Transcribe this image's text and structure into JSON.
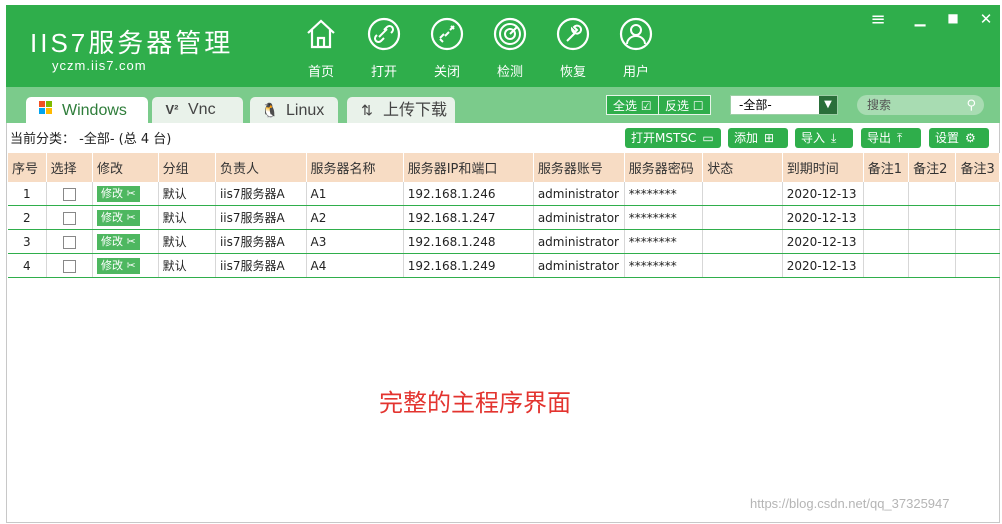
{
  "app": {
    "brand": "IIS7服务器管理",
    "domain": "yczm.iis7.com"
  },
  "toolbar": [
    {
      "label": "首页",
      "icon": "home-icon"
    },
    {
      "label": "打开",
      "icon": "link-icon"
    },
    {
      "label": "关闭",
      "icon": "unlink-icon"
    },
    {
      "label": "检测",
      "icon": "radar-icon"
    },
    {
      "label": "恢复",
      "icon": "wrench-icon"
    },
    {
      "label": "用户",
      "icon": "user-icon"
    }
  ],
  "tabs": [
    {
      "label": "Windows",
      "icon": "windows-icon",
      "active": true
    },
    {
      "label": "Vnc",
      "icon": "vnc-icon",
      "active": false
    },
    {
      "label": "Linux",
      "icon": "linux-icon",
      "active": false
    },
    {
      "label": "上传下载",
      "icon": "transfer-icon",
      "active": false
    }
  ],
  "filter": {
    "select_all": "全选",
    "invert_select": "反选",
    "group_value": "-全部-",
    "search_placeholder": "搜索"
  },
  "info": {
    "category_text": "当前分类： -全部- (总 4 台)"
  },
  "actions": {
    "open_mstsc": "打开MSTSC",
    "add": "添加",
    "import": "导入",
    "export": "导出",
    "settings": "设置"
  },
  "table": {
    "columns": [
      "序号",
      "选择",
      "修改",
      "分组",
      "负责人",
      "服务器名称",
      "服务器IP和端口",
      "服务器账号",
      "服务器密码",
      "状态",
      "到期时间",
      "备注1",
      "备注2",
      "备注3"
    ],
    "edit_label": "修改",
    "rows": [
      {
        "no": "1",
        "group": "默认",
        "owner": "iis7服务器A",
        "name": "A1",
        "ip": "192.168.1.246",
        "account": "administrator",
        "password": "********",
        "status": "",
        "expire": "2020-12-13"
      },
      {
        "no": "2",
        "group": "默认",
        "owner": "iis7服务器A",
        "name": "A2",
        "ip": "192.168.1.247",
        "account": "administrator",
        "password": "********",
        "status": "",
        "expire": "2020-12-13"
      },
      {
        "no": "3",
        "group": "默认",
        "owner": "iis7服务器A",
        "name": "A3",
        "ip": "192.168.1.248",
        "account": "administrator",
        "password": "********",
        "status": "",
        "expire": "2020-12-13"
      },
      {
        "no": "4",
        "group": "默认",
        "owner": "iis7服务器A",
        "name": "A4",
        "ip": "192.168.1.249",
        "account": "administrator",
        "password": "********",
        "status": "",
        "expire": "2020-12-13"
      }
    ]
  },
  "caption": "完整的主程序界面",
  "watermark": "https://blog.csdn.net/qq_37325947",
  "colors": {
    "primary_green": "#2fae4b",
    "tab_strip": "#7bcb8b",
    "header_row": "#f7dcc4",
    "caption_red": "#e3342f"
  }
}
